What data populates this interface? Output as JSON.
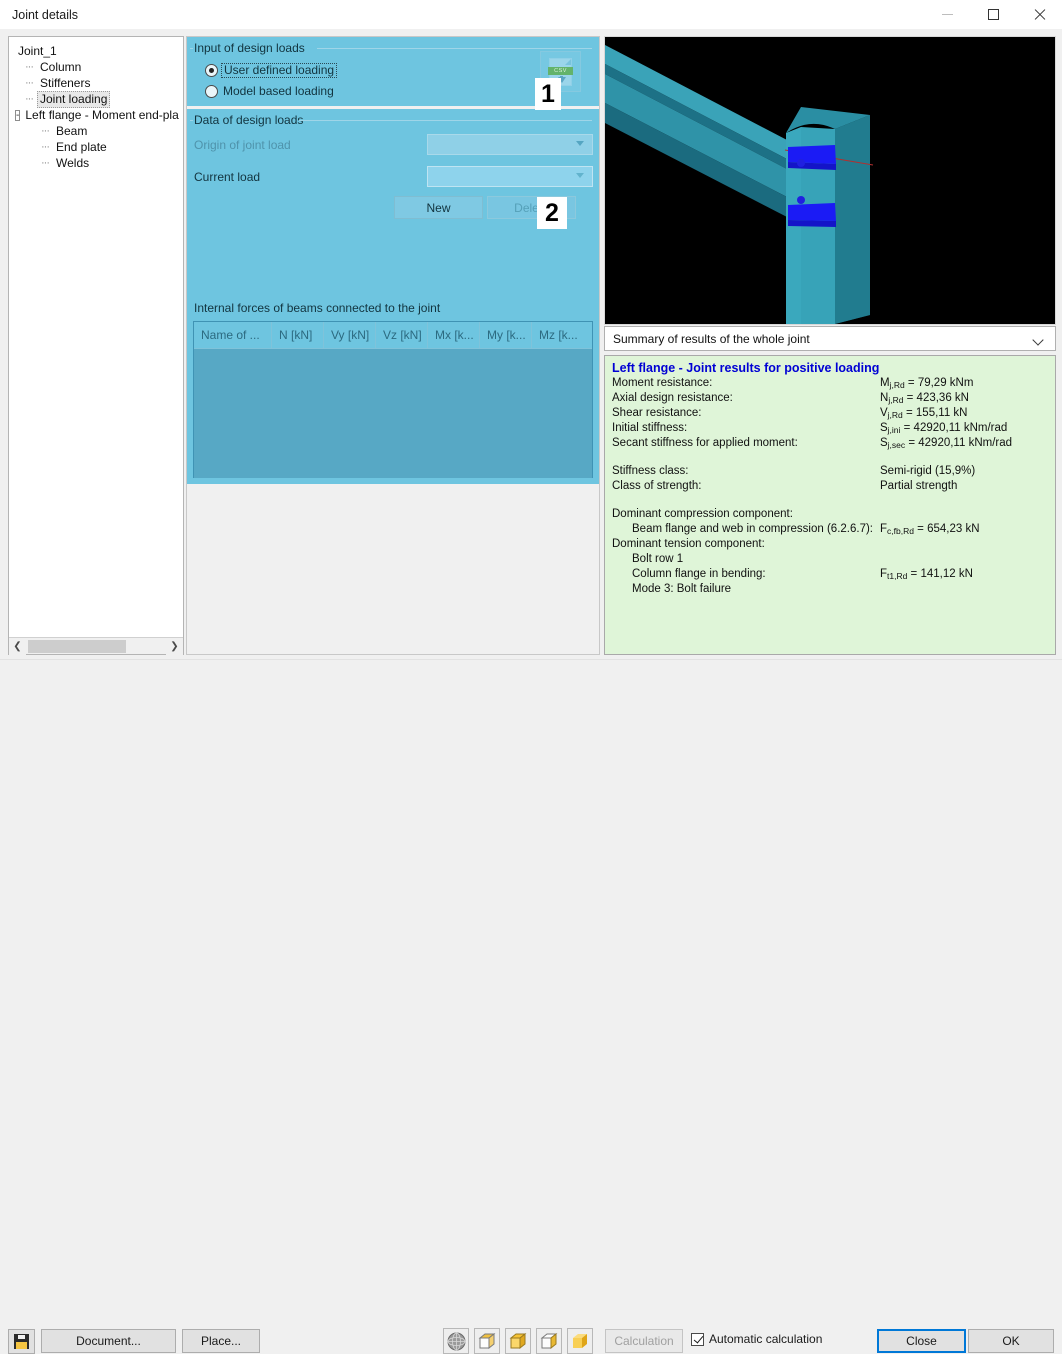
{
  "window": {
    "title": "Joint details",
    "minimize_label": "minimize",
    "maximize_label": "maximize",
    "close_label": "close"
  },
  "tree": {
    "root": "Joint_1",
    "items": [
      {
        "label": "Column",
        "level": 1,
        "selected": false
      },
      {
        "label": "Stiffeners",
        "level": 1,
        "selected": false
      },
      {
        "label": "Joint loading",
        "level": 1,
        "selected": true
      },
      {
        "label": "Left flange - Moment end-pla",
        "level": 1,
        "selected": false,
        "expander": "-"
      },
      {
        "label": "Beam",
        "level": 2,
        "selected": false
      },
      {
        "label": "End plate",
        "level": 2,
        "selected": false
      },
      {
        "label": "Welds",
        "level": 2,
        "selected": false
      }
    ]
  },
  "input_group": {
    "title": "Input of design loads",
    "radio_user": "User defined loading",
    "radio_model": "Model based loading",
    "selected": "user",
    "csv_icon": "csv-download-icon",
    "csv_label": "CSV",
    "step_badge": "1"
  },
  "data_group": {
    "title": "Data of design loads",
    "origin_label": "Origin of joint load",
    "origin_value": "",
    "current_label": "Current load",
    "current_value": "",
    "new_button": "New",
    "delete_button": "Delete",
    "step_badge": "2"
  },
  "forces": {
    "caption": "Internal forces of beams connected to the joint",
    "columns": [
      "Name of ...",
      "N [kN]",
      "Vy [kN]",
      "Vz [kN]",
      "Mx [k...",
      "My [k...",
      "Mz [k..."
    ],
    "rows": []
  },
  "viewport": {
    "name": "3d-joint-viewport",
    "background": "#000000",
    "steel_color": "#2b8fa3",
    "plate_color": "#1b1bff",
    "axis_color": "#a03030"
  },
  "results": {
    "selector_value": "Summary of results of the whole joint",
    "title": "Left flange - Joint results for positive loading",
    "rows": [
      {
        "key": "Moment resistance:",
        "sym": "M",
        "sub": "j,Rd",
        "val": " = 79,29 kNm"
      },
      {
        "key": "Axial design resistance:",
        "sym": "N",
        "sub": "j,Rd",
        "val": " = 423,36 kN"
      },
      {
        "key": "Shear resistance:",
        "sym": "V",
        "sub": "j,Rd",
        "val": " = 155,11 kN"
      },
      {
        "key": "Initial stiffness:",
        "sym": "S",
        "sub": "j,ini",
        "val": " = 42920,11 kNm/rad"
      },
      {
        "key": "Secant stiffness for applied moment:",
        "sym": "S",
        "sub": "j,sec",
        "val": " = 42920,11 kNm/rad"
      }
    ],
    "class_rows": [
      {
        "key": "Stiffness class:",
        "val": "Semi-rigid (15,9%)"
      },
      {
        "key": "Class of strength:",
        "val": "Partial strength"
      }
    ],
    "compression_header": "Dominant compression component:",
    "compression_item": "Beam flange and web in compression (6.2.6.7):",
    "compression_sym": "F",
    "compression_sub": "c,fb,Rd",
    "compression_val": " = 654,23 kN",
    "tension_header": "Dominant tension component:",
    "tension_row1": "Bolt row 1",
    "tension_item": "Column flange in bending:",
    "tension_sym": "F",
    "tension_sub": "t1,Rd",
    "tension_val": " = 141,12 kN",
    "tension_mode": "Mode 3: Bolt failure"
  },
  "bottom": {
    "save_icon": "save-floppy-icon",
    "document_button": "Document...",
    "place_button": "Place...",
    "view_icons": [
      "render-sphere-icon",
      "wireframe-cube-icon",
      "shaded-cube-icon",
      "hidden-line-cube-icon",
      "solid-cube-icon"
    ],
    "calculation_button": "Calculation",
    "auto_calc_label": "Automatic calculation",
    "auto_calc_checked": true,
    "close_button": "Close",
    "ok_button": "OK"
  }
}
